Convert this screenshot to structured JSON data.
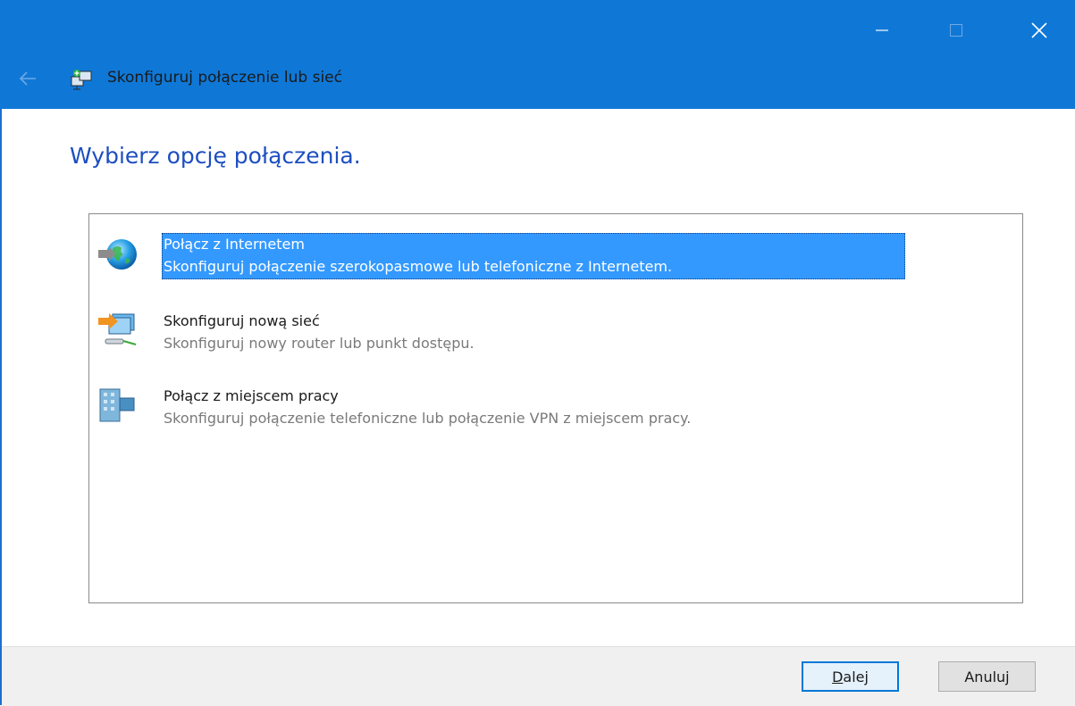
{
  "window": {
    "title": "Skonfiguruj połączenie lub sieć",
    "controls": {
      "minimize_icon": "minimize-icon",
      "maximize_icon": "maximize-icon",
      "close_icon": "close-icon"
    },
    "back_icon": "back-arrow-icon",
    "app_icon": "network-setup-icon",
    "accent_color": "#0f78d7"
  },
  "content": {
    "heading": "Wybierz opcję połączenia.",
    "options": [
      {
        "title": "Połącz z Internetem",
        "description": "Skonfiguruj połączenie szerokopasmowe lub telefoniczne z Internetem.",
        "icon": "globe-icon",
        "selected": true
      },
      {
        "title": "Skonfiguruj nową sieć",
        "description": "Skonfiguruj nowy router lub punkt dostępu.",
        "icon": "new-network-icon",
        "selected": false
      },
      {
        "title": "Połącz z miejscem pracy",
        "description": "Skonfiguruj połączenie telefoniczne lub połączenie VPN z miejscem pracy.",
        "icon": "workplace-icon",
        "selected": false
      }
    ],
    "selection_color": "#3399ff"
  },
  "footer": {
    "next_label_underlined": "D",
    "next_label_rest": "alej",
    "cancel_label": "Anuluj"
  }
}
